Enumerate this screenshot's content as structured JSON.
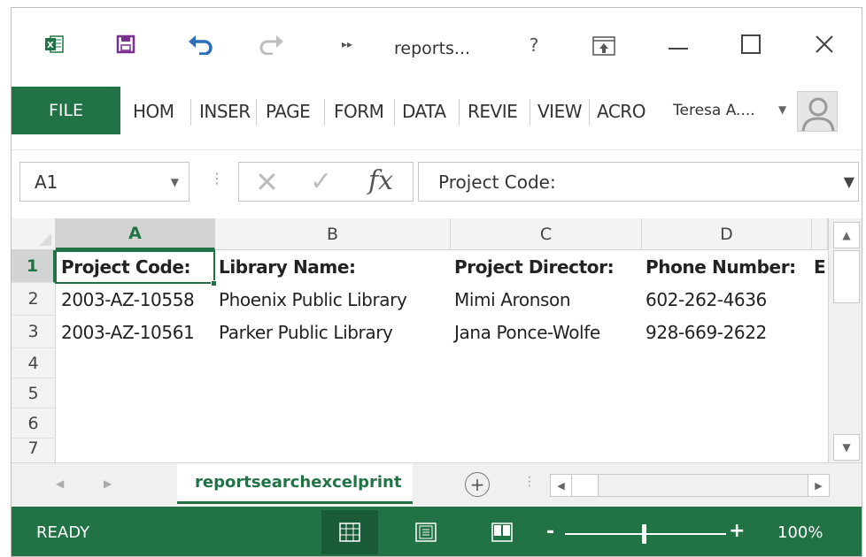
{
  "titlebar": {
    "doc_title": "reports...",
    "help_label": "?"
  },
  "ribbon": {
    "file_label": "FILE",
    "tabs": [
      "HOM",
      "INSER",
      "PAGE",
      "FORM",
      "DATA",
      "REVIE",
      "VIEW",
      "ACRO"
    ],
    "user_name": "Teresa A...."
  },
  "formula_bar": {
    "name_box": "A1",
    "formula": "Project Code:",
    "fx_label": "fx"
  },
  "grid": {
    "columns": [
      "A",
      "B",
      "C",
      "D"
    ],
    "rows": [
      "1",
      "2",
      "3",
      "4",
      "5",
      "6",
      "7"
    ],
    "cells": [
      [
        "Project Code:",
        "Library Name:",
        "Project Director:",
        "Phone Number:",
        "E"
      ],
      [
        "2003-AZ-10558",
        "Phoenix Public Library",
        "Mimi Aronson",
        "602-262-4636",
        ""
      ],
      [
        "2003-AZ-10561",
        "Parker Public Library",
        "Jana Ponce-Wolfe",
        "928-669-2622",
        ""
      ]
    ],
    "selected_cell": "A1"
  },
  "sheets": {
    "active_sheet": "reportsearchexcelprint",
    "add_label": "+"
  },
  "statusbar": {
    "status": "READY",
    "zoom": "100%",
    "zoom_minus": "-",
    "zoom_plus": "+",
    "zoom_percent": 100
  },
  "colors": {
    "accent": "#217346",
    "header_bg": "#f3f3f3",
    "active_header_bg": "#d3d3d3"
  },
  "icons": [
    "excel-logo-icon",
    "save-icon",
    "undo-icon",
    "redo-icon",
    "more-icon",
    "ribbon-display-options-icon",
    "minimize-icon",
    "maximize-icon",
    "close-icon",
    "avatar-icon",
    "chevron-down-icon",
    "cancel-icon",
    "enter-icon",
    "function-icon",
    "normal-view-icon",
    "page-layout-view-icon",
    "page-break-view-icon"
  ]
}
